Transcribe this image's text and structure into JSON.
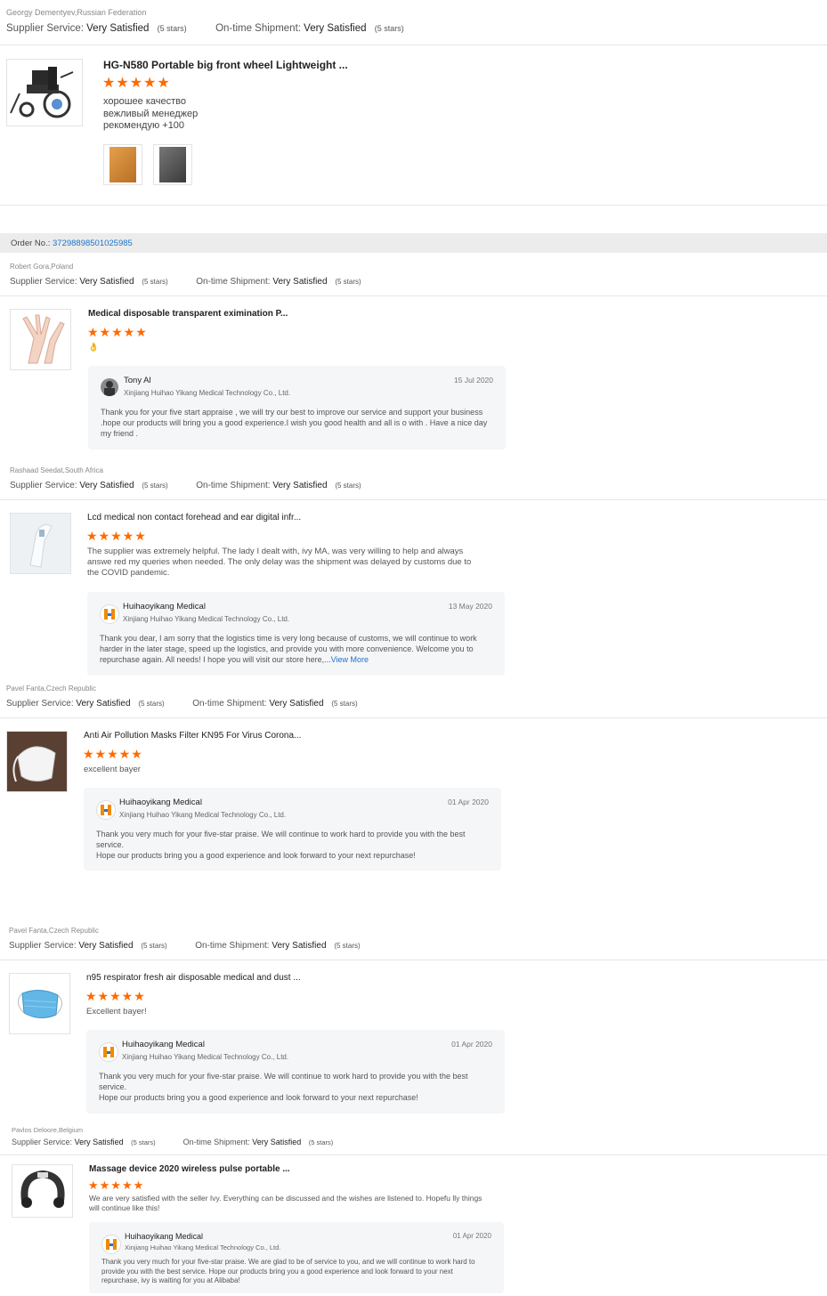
{
  "colors": {
    "star": "#ff6a00",
    "link": "#1a73c9"
  },
  "order": {
    "label": "Order No.:",
    "number": "37298898501025985"
  },
  "reviews": [
    {
      "reviewer": "Georgy Dementyev,Russian Federation",
      "supplier_label": "Supplier Service:",
      "supplier_value": "Very Satisfied",
      "supplier_stars": "(5 stars)",
      "shipment_label": "On-time Shipment:",
      "shipment_value": "Very Satisfied",
      "shipment_stars": "(5 stars)",
      "product_title": "HG-N580 Portable big front wheel Lightweight ...",
      "stars": "★★★★★",
      "text_lines": [
        "хорошее качество",
        "вежливый менеджер",
        "рекомендую +100"
      ],
      "icon": "wheelchair-image"
    },
    {
      "reviewer": "Robert Gora,Poland",
      "supplier_label": "Supplier Service:",
      "supplier_value": "Very Satisfied",
      "supplier_stars": "(5 stars)",
      "shipment_label": "On-time Shipment:",
      "shipment_value": "Very Satisfied",
      "shipment_stars": "(5 stars)",
      "product_title": "Medical disposable transparent eximination P...",
      "stars": "★★★★★",
      "text": "👌",
      "reply": {
        "name": "Tony Al",
        "company": "Xinjiang Huihao Yikang Medical Technology Co., Ltd.",
        "date": "15 Jul 2020",
        "body": "Thank you for your five start appraise , we will try our best to improve our service  and support your business .hope our products will bring you a good experience.I wish you good health and all is o with . Have a nice day my friend ."
      }
    },
    {
      "reviewer": "Rashaad Seedat,South Africa",
      "supplier_label": "Supplier Service:",
      "supplier_value": "Very Satisfied",
      "supplier_stars": "(5 stars)",
      "shipment_label": "On-time Shipment:",
      "shipment_value": "Very Satisfied",
      "shipment_stars": "(5 stars)",
      "product_title": "Lcd medical non contact forehead and ear digital infr...",
      "stars": "★★★★★",
      "text": "The supplier was extremely helpful. The lady I dealt with, ivy MA, was very willing to help and always answe red my queries when needed. The only delay was the shipment was delayed by customs due to the COVID pandemic.",
      "reply": {
        "name": "Huihaoyikang Medical",
        "company": "Xinjiang Huihao Yikang Medical Technology Co., Ltd.",
        "date": "13 May 2020",
        "body": "Thank you dear, I am sorry that the logistics time is very long because of customs, we will continue to work harder in the later stage, speed up the logistics, and provide you with more convenience. Welcome you to repurchase again. All needs! I hope you will visit our store here,...",
        "view_more": "View More"
      }
    },
    {
      "reviewer": "Pavel Fanta,Czech Republic",
      "supplier_label": "Supplier Service:",
      "supplier_value": "Very Satisfied",
      "supplier_stars": "(5 stars)",
      "shipment_label": "On-time Shipment:",
      "shipment_value": "Very Satisfied",
      "shipment_stars": "(5 stars)",
      "product_title": "Anti Air Pollution Masks Filter KN95 For Virus Corona...",
      "stars": "★★★★★",
      "text": "excellent bayer",
      "reply": {
        "name": "Huihaoyikang Medical",
        "company": "Xinjiang Huihao Yikang Medical Technology Co., Ltd.",
        "date": "01 Apr 2020",
        "body_lines": [
          "Thank you very much for your five-star praise. We will continue to work hard to provide you with the best service.",
          "Hope our products bring you a good experience and look forward to your next repurchase!"
        ]
      }
    },
    {
      "reviewer": "Pavel Fanta,Czech Republic",
      "supplier_label": "Supplier Service:",
      "supplier_value": "Very Satisfied",
      "supplier_stars": "(5 stars)",
      "shipment_label": "On-time Shipment:",
      "shipment_value": "Very Satisfied",
      "shipment_stars": "(5 stars)",
      "product_title": "n95 respirator fresh air disposable medical and dust ...",
      "stars": "★★★★★",
      "text": "Excellent bayer!",
      "reply": {
        "name": "Huihaoyikang Medical",
        "company": "Xinjiang Huihao Yikang Medical Technology Co., Ltd.",
        "date": "01 Apr 2020",
        "body_lines": [
          "Thank you very much for your five-star praise. We will continue to work hard to provide you with the best service.",
          "Hope our products bring you a good experience and look forward to your next repurchase!"
        ]
      }
    },
    {
      "reviewer": "Pavlos Deloore,Belgium",
      "supplier_label": "Supplier Service:",
      "supplier_value": "Very Satisfied",
      "supplier_stars": "(5 stars)",
      "shipment_label": "On-time Shipment:",
      "shipment_value": "Very Satisfied",
      "shipment_stars": "(5 stars)",
      "product_title": "Massage device 2020 wireless pulse portable ...",
      "stars": "★★★★★",
      "text": "We are very satisfied with the seller Ivy. Everything can be discussed and the wishes are listened to. Hopefu lly things will continue like this!",
      "reply": {
        "name": "Huihaoyikang Medical",
        "company": "Xinjiang Huihao Yikang Medical Technology Co., Ltd.",
        "date": "01 Apr 2020",
        "body": "Thank you very much for your five-star praise. We are glad to be of service to you, and we will continue to work hard to provide you with the best service. Hope our products bring you a good experience and look forward to your next repurchase, ivy is waiting for you at Alibaba!"
      }
    }
  ]
}
